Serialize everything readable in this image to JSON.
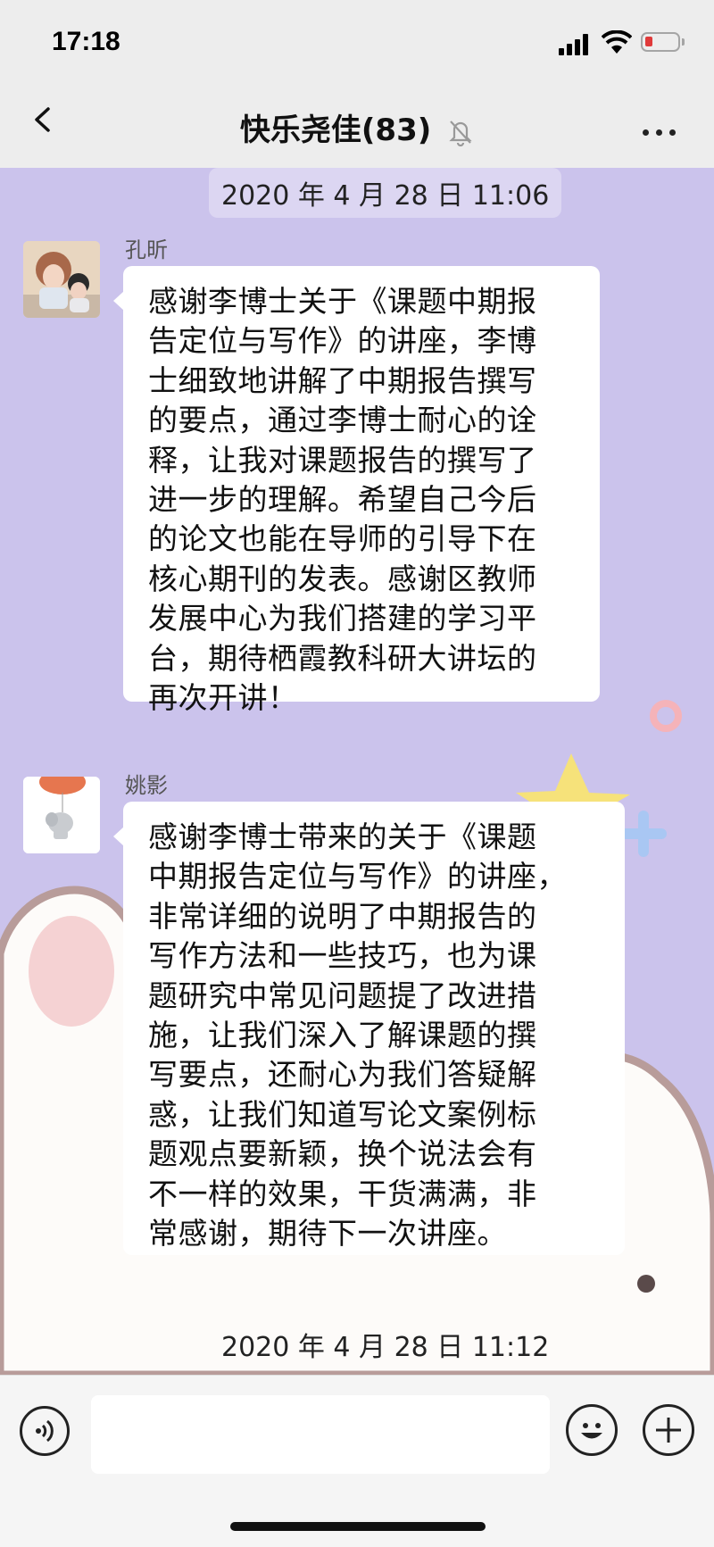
{
  "status_bar": {
    "time": "17:18"
  },
  "nav": {
    "title": "快乐尧佳(83)",
    "back_icon": "chevron-left-icon",
    "mute_icon": "bell-muted-icon",
    "more_icon": "more-dots-icon"
  },
  "messages": [
    {
      "type": "timestamp",
      "text": "2020 年 4 月 28 日 11:06"
    },
    {
      "type": "message",
      "sender": "孔昕",
      "avatar": "photo-avatar",
      "lines": [
        "感谢李博士关于《课题中期报",
        "告定位与写作》的讲座，李博",
        "士细致地讲解了中期报告撰写",
        "的要点，通过李博士耐心的诠",
        "释，让我对课题报告的撰写了",
        "进一步的理解。希望自己今后",
        "的论文也能在导师的引导下在",
        "核心期刊的发表。感谢区教师",
        "发展中心为我们搭建的学习平",
        "台，期待栖霞教科研大讲坛的",
        "再次开讲！"
      ]
    },
    {
      "type": "message",
      "sender": "姚影",
      "avatar": "elephant-balloon-avatar",
      "lines": [
        "感谢李博士带来的关于《课题",
        "中期报告定位与写作》的讲座，",
        "非常详细的说明了中期报告的",
        "写作方法和一些技巧，也为课",
        "题研究中常见问题提了改进措",
        "施，让我们深入了解课题的撰",
        "写要点，还耐心为我们答疑解",
        "惑，让我们知道写论文案例标",
        "题观点要新颖，换个说法会有",
        "不一样的效果，干货满满，非",
        "常感谢，期待下一次讲座。"
      ]
    },
    {
      "type": "timestamp",
      "text": "2020 年 4 月 28 日  11:12"
    }
  ],
  "input_bar": {
    "voice_icon": "voice-icon",
    "emoji_icon": "emoji-icon",
    "plus_icon": "plus-icon",
    "input_value": ""
  },
  "colors": {
    "chat_background": "#cbc3ec",
    "bubble": "#ffffff",
    "nav_background": "#ededed"
  }
}
